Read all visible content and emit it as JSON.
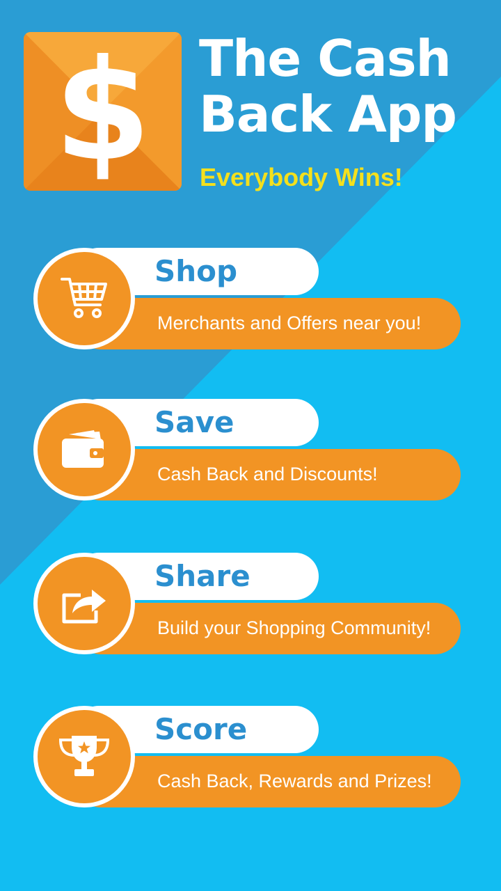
{
  "app": {
    "title_line1": "The Cash",
    "title_line2": "Back App",
    "tagline": "Everybody Wins!",
    "logo_symbol": "$"
  },
  "features": [
    {
      "heading": "Shop",
      "description": "Merchants and Offers near you!",
      "icon": "shopping-cart-icon"
    },
    {
      "heading": "Save",
      "description": "Cash Back and Discounts!",
      "icon": "wallet-icon"
    },
    {
      "heading": "Share",
      "description": "Build your Shopping Community!",
      "icon": "share-icon"
    },
    {
      "heading": "Score",
      "description": "Cash Back, Rewards and Prizes!",
      "icon": "trophy-icon"
    }
  ],
  "colors": {
    "background": "#12bdf2",
    "background_shadow": "#2a9dd4",
    "accent_orange": "#f29424",
    "heading_blue": "#2b8fcf",
    "tagline_yellow": "#f4e01d"
  }
}
